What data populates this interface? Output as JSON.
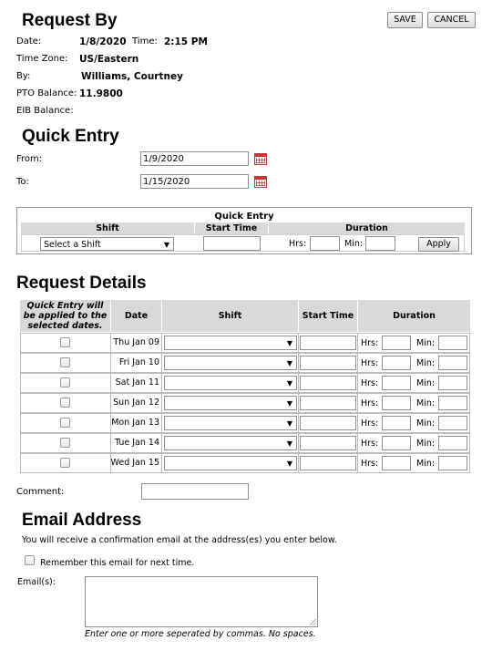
{
  "header": {
    "title": "Request By",
    "save_label": "SAVE",
    "cancel_label": "CANCEL"
  },
  "request_by": {
    "date_label": "Date:",
    "date_value": "1/8/2020",
    "time_label": "Time:",
    "time_value": "2:15 PM",
    "timezone_label": "Time Zone:",
    "timezone_value": "US/Eastern",
    "by_label": "By:",
    "by_value": "Williams, Courtney",
    "pto_label": "PTO Balance:",
    "pto_value": "11.9800",
    "eib_label": "EIB Balance:"
  },
  "quick_entry": {
    "title": "Quick Entry",
    "from_label": "From:",
    "from_value": "1/9/2020",
    "to_label": "To:",
    "to_value": "1/15/2020",
    "box_title": "Quick Entry",
    "col_shift": "Shift",
    "col_start": "Start Time",
    "col_duration": "Duration",
    "shift_placeholder": "Select a Shift",
    "hrs_label": "Hrs:",
    "min_label": "Min:",
    "apply_label": "Apply"
  },
  "request_details": {
    "title": "Request Details",
    "col_quick_entry": "Quick Entry will be applied to the selected dates.",
    "col_date": "Date",
    "col_shift": "Shift",
    "col_start": "Start Time",
    "col_duration": "Duration",
    "hrs_label": "Hrs:",
    "min_label": "Min:",
    "rows": [
      {
        "date": "Thu Jan 09"
      },
      {
        "date": "Fri Jan 10"
      },
      {
        "date": "Sat Jan 11"
      },
      {
        "date": "Sun Jan 12"
      },
      {
        "date": "Mon Jan 13"
      },
      {
        "date": "Tue Jan 14"
      },
      {
        "date": "Wed Jan 15"
      }
    ]
  },
  "comment": {
    "label": "Comment:"
  },
  "email": {
    "title": "Email Address",
    "info": "You will receive a confirmation email at the address(es) you enter below.",
    "remember_label": "Remember this email for next time.",
    "emails_label": "Email(s):",
    "hint": "Enter one or more seperated by commas. No spaces."
  }
}
